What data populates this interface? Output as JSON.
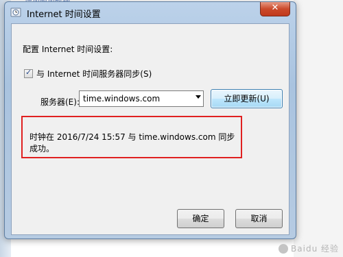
{
  "background": {
    "partial_text": "增加附加时钟"
  },
  "watermark": {
    "text": "Baidu 经验"
  },
  "dialog": {
    "title": "Internet 时间设置",
    "close_glyph": "✕",
    "config_label": "配置 Internet 时间设置:",
    "sync_checkbox_label": "与 Internet 时间服务器同步(S)",
    "sync_checked": true,
    "server_label": "服务器(E):",
    "server_value": "time.windows.com",
    "update_button": "立即更新(U)",
    "status_message": "时钟在 2016/7/24 15:57 与 time.windows.com 同步成功。",
    "ok_button": "确定",
    "cancel_button": "取消"
  },
  "colors": {
    "highlight_border": "#e02020",
    "frame": "#a9c3df",
    "close_button": "#c03a1e"
  }
}
